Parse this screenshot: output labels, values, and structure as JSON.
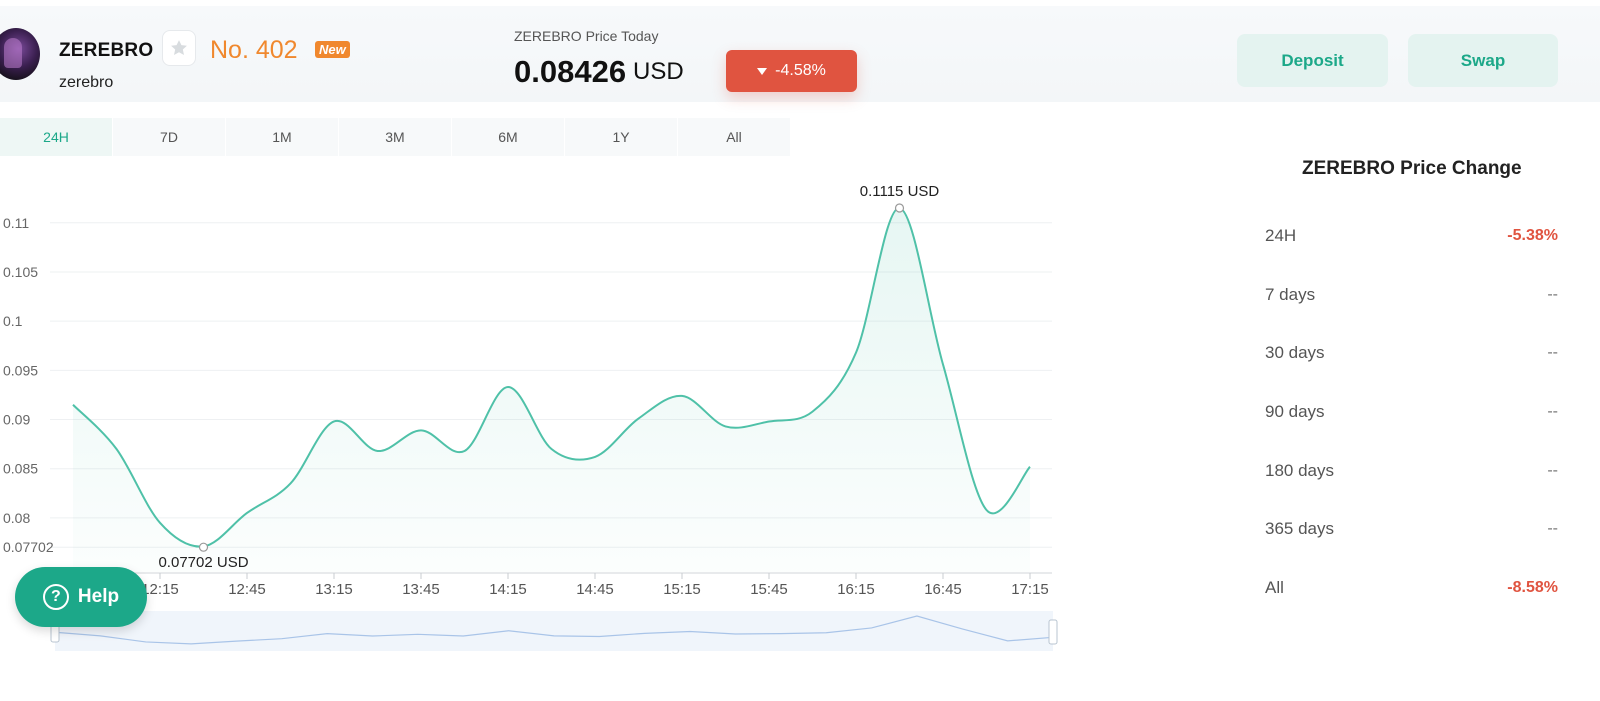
{
  "coin": {
    "symbol": "ZEREBRO",
    "name": "zerebro",
    "rank": "No. 402",
    "badge": "New"
  },
  "price": {
    "label": "ZEREBRO Price Today",
    "value": "0.08426",
    "unit": "USD",
    "change": "-4.58%"
  },
  "actions": {
    "deposit": "Deposit",
    "swap": "Swap"
  },
  "tabs": [
    {
      "label": "24H",
      "active": true
    },
    {
      "label": "7D"
    },
    {
      "label": "1M"
    },
    {
      "label": "3M"
    },
    {
      "label": "6M"
    },
    {
      "label": "1Y"
    },
    {
      "label": "All"
    }
  ],
  "chart_data": {
    "type": "area",
    "x": [
      "11:45",
      "12:00",
      "12:15",
      "12:30",
      "12:45",
      "13:00",
      "13:15",
      "13:30",
      "13:45",
      "14:00",
      "14:15",
      "14:30",
      "14:45",
      "15:00",
      "15:15",
      "15:30",
      "15:45",
      "16:00",
      "16:15",
      "16:30",
      "16:45",
      "17:00",
      "17:15"
    ],
    "values": [
      0.0915,
      0.087,
      0.0795,
      0.0771,
      0.0805,
      0.0835,
      0.0898,
      0.0868,
      0.0889,
      0.0868,
      0.0933,
      0.087,
      0.0862,
      0.0901,
      0.0924,
      0.0893,
      0.0898,
      0.0908,
      0.0968,
      0.1115,
      0.0956,
      0.0808,
      0.0852
    ],
    "x_ticks": [
      "12:15",
      "12:45",
      "13:15",
      "13:45",
      "14:15",
      "14:45",
      "15:15",
      "15:45",
      "16:15",
      "16:45",
      "17:15"
    ],
    "y_ticks": [
      "0.11",
      "0.105",
      "0.1",
      "0.095",
      "0.09",
      "0.085",
      "0.08",
      "0.07702"
    ],
    "y_tick_values": [
      0.11,
      0.105,
      0.1,
      0.095,
      0.09,
      0.085,
      0.08,
      0.07702
    ],
    "ylim": [
      0.0745,
      0.1115
    ],
    "max_label": {
      "value": "0.1115",
      "unit": "USD",
      "x": "16:30",
      "y": 0.1115
    },
    "min_label": {
      "value": "0.07702",
      "unit": "USD",
      "x": "12:30",
      "y": 0.07702
    },
    "line_color": "#4fc1a8",
    "grid": true
  },
  "price_change": {
    "title": "ZEREBRO Price Change",
    "rows": [
      {
        "label": "24H",
        "value": "-5.38%",
        "neg": true
      },
      {
        "label": "7 days",
        "value": "--"
      },
      {
        "label": "30 days",
        "value": "--"
      },
      {
        "label": "90 days",
        "value": "--"
      },
      {
        "label": "180 days",
        "value": "--"
      },
      {
        "label": "365 days",
        "value": "--"
      },
      {
        "label": "All",
        "value": "-8.58%",
        "neg": true
      }
    ]
  },
  "help": {
    "label": "Help"
  },
  "colors": {
    "accent": "#1ca889",
    "negative": "#e05440",
    "rank": "#f0882e"
  },
  "icons": {
    "favorite": "star-icon",
    "change": "triangle-down-icon",
    "help": "question-circle-icon"
  }
}
